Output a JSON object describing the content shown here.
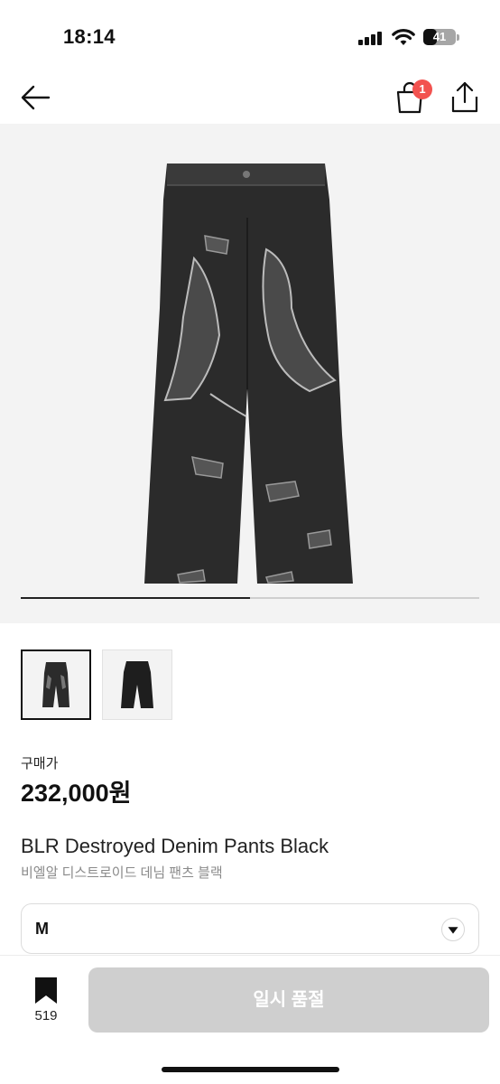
{
  "status_bar": {
    "time": "18:14",
    "battery": "41",
    "battery_level": 0.41
  },
  "nav": {
    "back_icon": "arrow-left-icon",
    "cart_icon": "shopping-bag-icon",
    "cart_badge": "1",
    "share_icon": "share-icon"
  },
  "gallery": {
    "image_count": 2,
    "current_index": 1,
    "progress_fraction": 0.5
  },
  "product": {
    "price_label": "구매가",
    "price": "232,000원",
    "title_en": "BLR Destroyed Denim Pants Black",
    "title_ko": "비엘알 디스트로이드 데님 팬츠 블랙"
  },
  "size_select": {
    "value": "M",
    "arrow_icon": "caret-down-icon"
  },
  "bottom_bar": {
    "bookmark_icon": "bookmark-icon",
    "bookmark_count": "519",
    "buy_button_label": "일시 품절"
  },
  "colors": {
    "badge": "#f2524f",
    "disabled_button": "#cfcfcf",
    "gallery_bg": "#f3f3f3"
  }
}
